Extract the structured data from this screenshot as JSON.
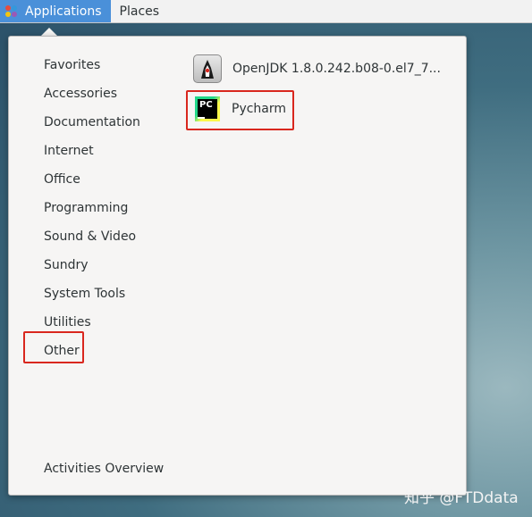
{
  "topbar": {
    "applications_label": "Applications",
    "places_label": "Places"
  },
  "menu": {
    "categories": [
      {
        "label": "Favorites"
      },
      {
        "label": "Accessories"
      },
      {
        "label": "Documentation"
      },
      {
        "label": "Internet"
      },
      {
        "label": "Office"
      },
      {
        "label": "Programming"
      },
      {
        "label": "Sound & Video"
      },
      {
        "label": "Sundry"
      },
      {
        "label": "System Tools"
      },
      {
        "label": "Utilities"
      },
      {
        "label": "Other"
      }
    ],
    "apps": [
      {
        "label": "OpenJDK 1.8.0.242.b08-0.el7_7...",
        "icon": "java-icon"
      },
      {
        "label": "Pycharm",
        "icon": "pycharm-icon",
        "icon_text": "PC"
      }
    ],
    "activities_label": "Activities Overview"
  },
  "watermark": "知乎 @FTDdata",
  "colors": {
    "accent": "#4a90d9",
    "highlight_box": "#d9271e",
    "menu_bg": "#f6f5f4"
  }
}
